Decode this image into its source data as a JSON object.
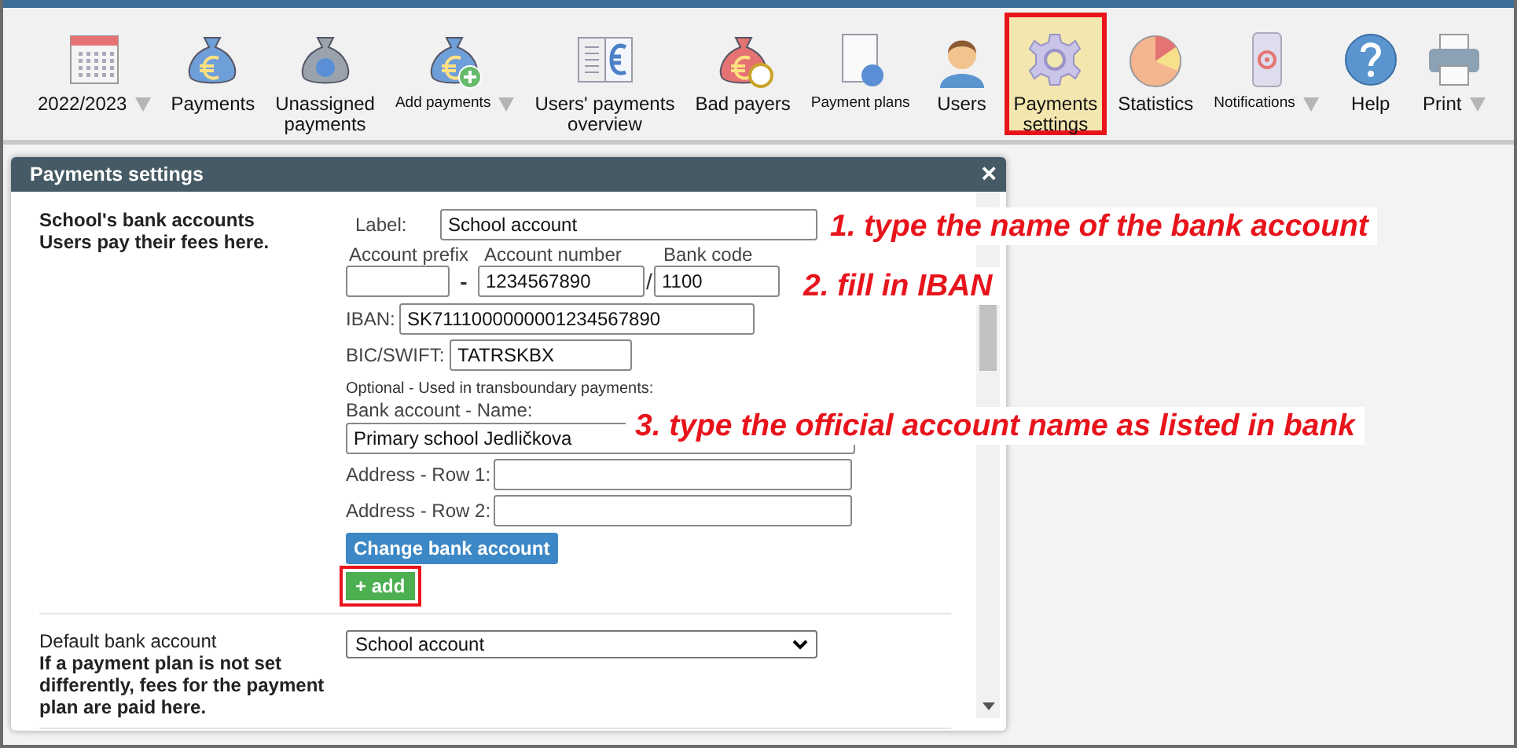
{
  "toolbar": {
    "items": [
      {
        "label": "2022/2023",
        "kind": "normal",
        "dropdown": true,
        "highlighted": false
      },
      {
        "label": "Payments",
        "kind": "normal",
        "dropdown": false,
        "highlighted": false
      },
      {
        "label_lines": [
          "Unassigned",
          "payments"
        ],
        "kind": "normal",
        "dropdown": false,
        "highlighted": false
      },
      {
        "label": "Add payments",
        "kind": "compact",
        "dropdown": true,
        "highlighted": false
      },
      {
        "label_lines": [
          "Users' payments",
          "overview"
        ],
        "kind": "normal",
        "dropdown": false,
        "highlighted": false
      },
      {
        "label": "Bad payers",
        "kind": "normal",
        "dropdown": false,
        "highlighted": false
      },
      {
        "label": "Payment plans",
        "kind": "compact",
        "dropdown": false,
        "highlighted": false
      },
      {
        "label": "Users",
        "kind": "normal",
        "dropdown": false,
        "highlighted": false
      },
      {
        "label_lines": [
          "Payments",
          "settings"
        ],
        "kind": "normal",
        "dropdown": false,
        "highlighted": true
      },
      {
        "label": "Statistics",
        "kind": "normal",
        "dropdown": false,
        "highlighted": false
      },
      {
        "label": "Notifications",
        "kind": "compact",
        "dropdown": true,
        "highlighted": false
      },
      {
        "label": "Help",
        "kind": "normal",
        "dropdown": false,
        "highlighted": false
      },
      {
        "label": "Print",
        "kind": "normal",
        "dropdown": true,
        "highlighted": false
      }
    ]
  },
  "dialog": {
    "title": "Payments settings",
    "close": "×",
    "bank_section": {
      "title": "School's bank accounts",
      "description": "Users pay their fees here.",
      "label_label": "Label:",
      "label_value": "School account",
      "prefix_label": "Account prefix",
      "number_label": "Account number",
      "code_label": "Bank code",
      "dash": "-",
      "number_value": "1234567890",
      "slash": "/",
      "code_value": "1100",
      "iban_label": "IBAN:",
      "iban_value": "SK7111000000001234567890",
      "bic_label": "BIC/SWIFT:",
      "bic_value": "TATRSKBX",
      "optional_note": "Optional - Used in transboundary payments:",
      "name_label": "Bank account - Name:",
      "name_value": "Primary school Jedličkova",
      "address1_label": "Address - Row 1:",
      "address2_label": "Address - Row 2:",
      "change_button": "Change bank account",
      "add_button": {
        "label": "+ add",
        "highlighted": true
      }
    },
    "default_section": {
      "title": "Default bank account",
      "description": "If a payment plan is not set differently, fees for the payment plan are paid here.",
      "select_value": "School account"
    }
  },
  "annotations": [
    {
      "text": "1. type the name of the bank account"
    },
    {
      "text": "2. fill in IBAN"
    },
    {
      "text": "3. type the official account name as listed in bank"
    }
  ]
}
